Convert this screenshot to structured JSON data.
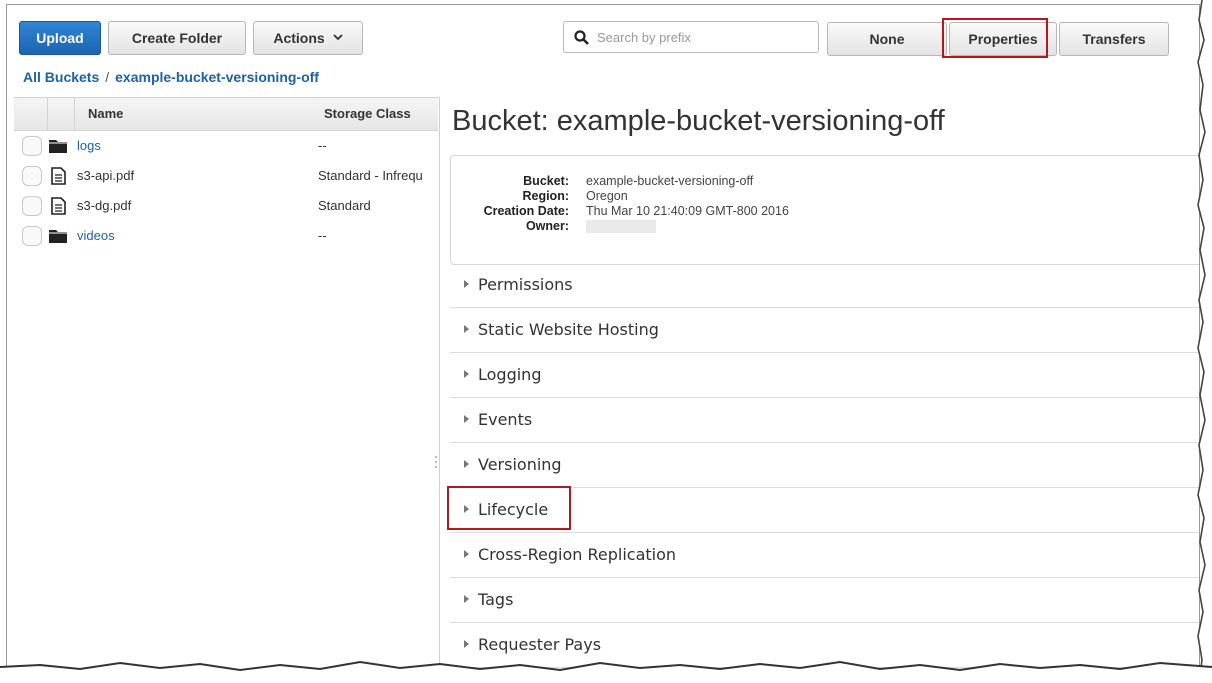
{
  "toolbar": {
    "upload_label": "Upload",
    "create_folder_label": "Create Folder",
    "actions_label": "Actions",
    "search_placeholder": "Search by prefix",
    "view_buttons": {
      "none": "None",
      "properties": "Properties",
      "transfers": "Transfers"
    }
  },
  "breadcrumb": {
    "root": "All Buckets",
    "separator": "/",
    "current": "example-bucket-versioning-off"
  },
  "table": {
    "columns": {
      "name": "Name",
      "storage_class": "Storage Class"
    },
    "rows": [
      {
        "type": "folder",
        "name": "logs",
        "storage_class": "--"
      },
      {
        "type": "file",
        "name": "s3-api.pdf",
        "storage_class": "Standard - Infrequ"
      },
      {
        "type": "file",
        "name": "s3-dg.pdf",
        "storage_class": "Standard"
      },
      {
        "type": "folder",
        "name": "videos",
        "storage_class": "--"
      }
    ]
  },
  "properties": {
    "title": "Bucket: example-bucket-versioning-off",
    "info": {
      "bucket_label": "Bucket:",
      "bucket_value": "example-bucket-versioning-off",
      "region_label": "Region:",
      "region_value": "Oregon",
      "creation_label": "Creation Date:",
      "creation_value": "Thu Mar 10 21:40:09 GMT-800 2016",
      "owner_label": "Owner:"
    },
    "sections": [
      "Permissions",
      "Static Website Hosting",
      "Logging",
      "Events",
      "Versioning",
      "Lifecycle",
      "Cross-Region Replication",
      "Tags",
      "Requester Pays"
    ]
  },
  "colors": {
    "primary_button": "#1c63b3",
    "link": "#1b62ad",
    "highlight": "#b4181f"
  },
  "icons": {
    "folder": "folder-icon",
    "file": "document-icon",
    "search": "search-icon",
    "dropdown": "chevron-down-icon"
  }
}
